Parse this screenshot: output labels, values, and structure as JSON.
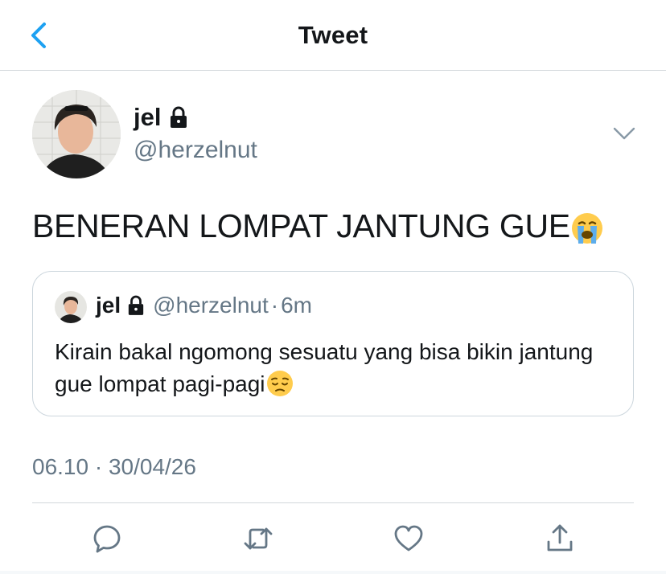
{
  "header": {
    "title": "Tweet",
    "back_icon": "chevron-left-icon"
  },
  "tweet": {
    "author_name": "jel",
    "author_handle": "@herzelnut",
    "text": "BENERAN LOMPAT JANTUNG GUE",
    "text_emoji": "loudly-crying-face-emoji",
    "timestamp": "06.10 · 30/04/26"
  },
  "quote": {
    "author_name": "jel",
    "author_handle": "@herzelnut",
    "separator": "·",
    "age": "6m",
    "text": "Kirain bakal ngomong sesuatu yang bisa bikin jantung gue lompat pagi-pagi",
    "text_emoji": "pensive-face-emoji"
  },
  "actions": [
    "reply-icon",
    "retweet-icon",
    "like-icon",
    "share-icon"
  ],
  "colors": {
    "accent": "#1da1f2",
    "secondary_text": "#657786",
    "border": "#ccd6dd"
  }
}
